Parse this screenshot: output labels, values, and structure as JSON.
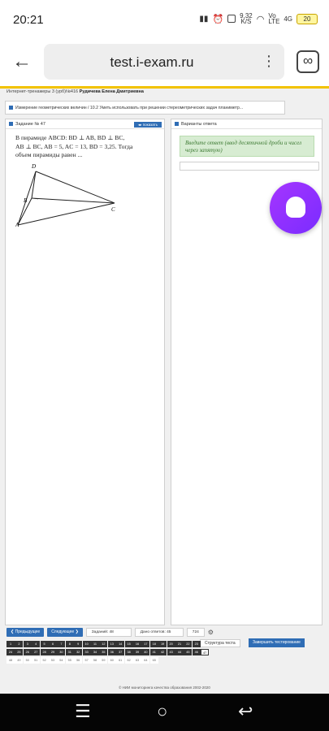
{
  "status_bar": {
    "time": "20:21",
    "net_speed": "9,32",
    "net_unit": "K/S",
    "network": "4G",
    "volte": "Vo LTE",
    "battery": "20"
  },
  "browser": {
    "url": "test.i-exam.ru",
    "tabs_symbol": "∞"
  },
  "page": {
    "user_line_prefix": "Интернет-тренажеры 3 (урб)№416",
    "user_name": "Рудичева Елена Дмитриевна",
    "breadcrumb": "Измерение геометрических величин / 10.2 Уметь использовать при решении стереометрических задач планиметр...",
    "task": {
      "header": "Задание № 47",
      "show_button": "показать",
      "text_line1": "В пирамиде ABCD: BD ⊥ AB, BD ⊥ BC,",
      "text_line2": "AB ⊥ BC, AB = 5, AC = 13, BD = 3,25. Тогда",
      "text_line3": "объем пирамиды равен ...",
      "points": [
        "D",
        "B",
        "C",
        "A"
      ]
    },
    "answer": {
      "header": "Варианты ответа",
      "hint": "Введите ответ (ввод десятичной дроби и чисел через запятую)",
      "value": ""
    },
    "nav": {
      "prev": "Предыдущее",
      "next": "Следующее",
      "task_count": "Заданий: 48",
      "answered_count": "Дано ответов: 45",
      "timer": "724",
      "structure": "Структура теста",
      "finish": "Завершить тестирование"
    },
    "numbers_done": [
      "1",
      "2",
      "3",
      "4",
      "5",
      "6",
      "7",
      "8",
      "9",
      "10",
      "11",
      "12",
      "13",
      "14",
      "15",
      "16",
      "17",
      "18",
      "19",
      "20",
      "21",
      "22",
      "23",
      "24",
      "25",
      "26",
      "27",
      "28",
      "29",
      "30",
      "31",
      "32",
      "33",
      "34",
      "35",
      "36",
      "37",
      "38",
      "39",
      "40",
      "41",
      "42",
      "43",
      "44",
      "45",
      "46"
    ],
    "current_number": "47",
    "numbers_todo": [
      "48",
      "49",
      "50",
      "51",
      "52",
      "53",
      "54",
      "55",
      "56",
      "57",
      "58",
      "59",
      "60",
      "61",
      "62",
      "63",
      "64",
      "65"
    ],
    "footer": "© НИИ мониторинга качества образования 2002-2020"
  }
}
